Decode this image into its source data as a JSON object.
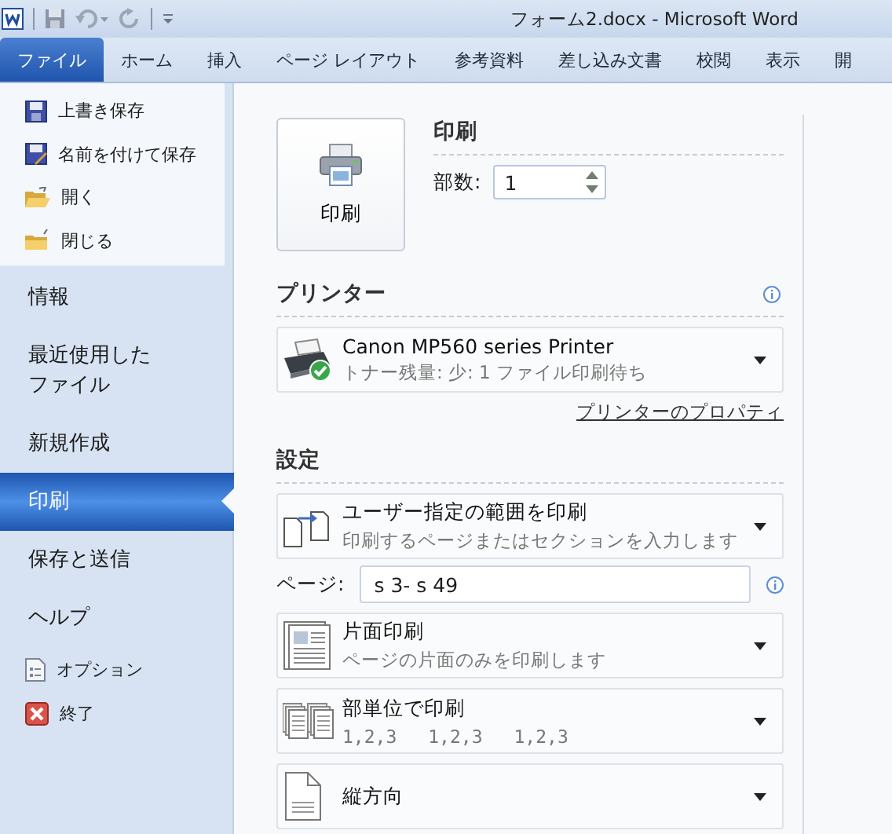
{
  "window": {
    "title": "フォーム2.docx - Microsoft Word"
  },
  "ribbon_tabs": [
    {
      "label": "ファイル",
      "selected": true
    },
    {
      "label": "ホーム",
      "selected": false
    },
    {
      "label": "挿入",
      "selected": false
    },
    {
      "label": "ページ レイアウト",
      "selected": false
    },
    {
      "label": "参考資料",
      "selected": false
    },
    {
      "label": "差し込み文書",
      "selected": false
    },
    {
      "label": "校閲",
      "selected": false
    },
    {
      "label": "表示",
      "selected": false
    },
    {
      "label": "開",
      "selected": false
    }
  ],
  "sidebar": {
    "file_commands": [
      "上書き保存",
      "名前を付けて保存",
      "開く",
      "閉じる"
    ],
    "nav": [
      {
        "label": "情報",
        "selected": false
      },
      {
        "label": "最近使用したファイル",
        "selected": false
      },
      {
        "label": "新規作成",
        "selected": false
      },
      {
        "label": "印刷",
        "selected": true
      },
      {
        "label": "保存と送信",
        "selected": false
      },
      {
        "label": "ヘルプ",
        "selected": false
      }
    ],
    "app_commands": [
      "オプション",
      "終了"
    ]
  },
  "print": {
    "button": "印刷",
    "heading": "印刷",
    "copies_label": "部数:",
    "copies": "1"
  },
  "printer": {
    "heading": "プリンター",
    "name": "Canon MP560 series Printer",
    "status": "トナー残量: 少: 1 ファイル印刷待ち",
    "properties_link": "プリンターのプロパティ"
  },
  "settings": {
    "heading": "設定",
    "items": [
      {
        "kind": "dropdown",
        "title": "ユーザー指定の範囲を印刷",
        "description": "印刷するページまたはセクションを入力します"
      },
      {
        "kind": "field",
        "label": "ページ:",
        "value": "s 3- s 49"
      },
      {
        "kind": "dropdown",
        "title": "片面印刷",
        "description": "ページの片面のみを印刷します"
      },
      {
        "kind": "collate",
        "title": "部単位で印刷",
        "sets": [
          "1,2,3",
          "1,2,3",
          "1,2,3"
        ]
      },
      {
        "kind": "dropdown",
        "title": "縦方向"
      }
    ]
  }
}
